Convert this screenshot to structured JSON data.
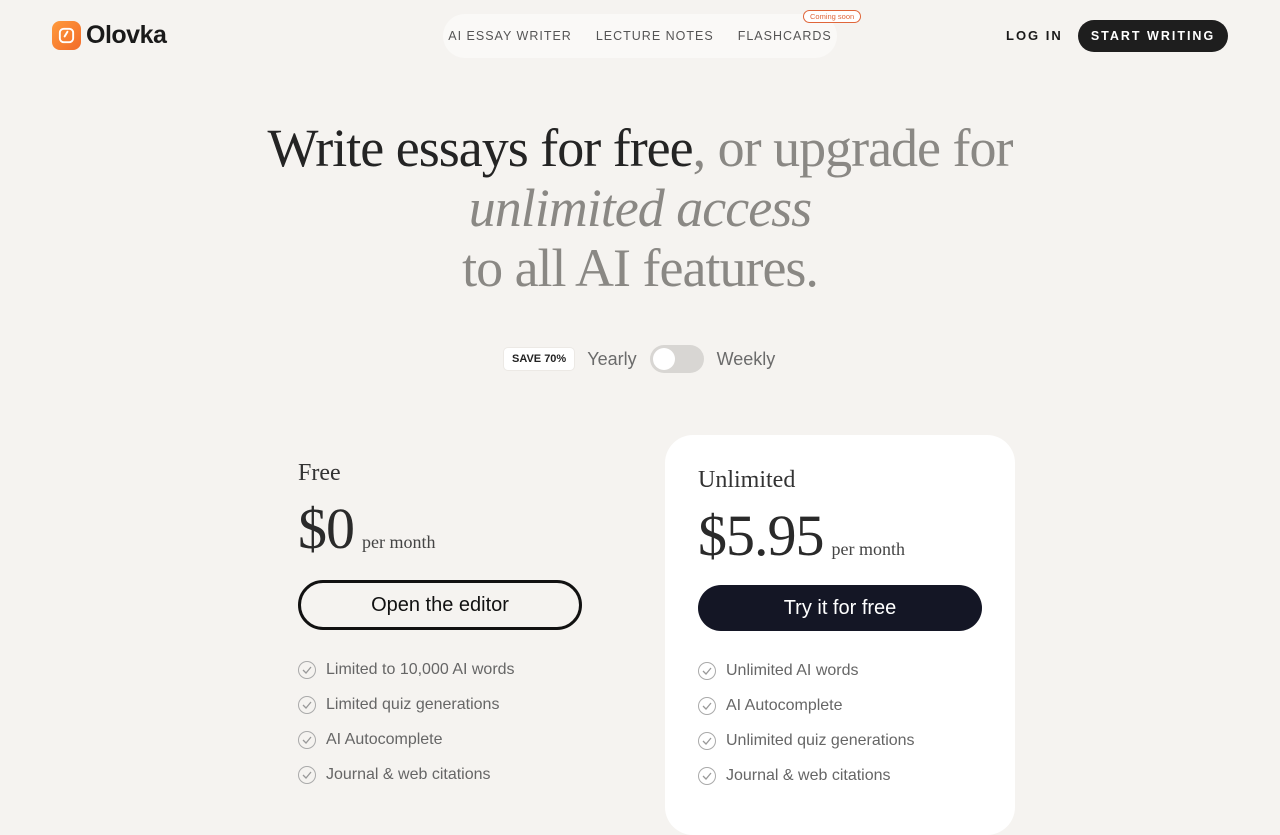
{
  "header": {
    "logo_text": "Olovka",
    "nav": [
      {
        "label": "AI ESSAY WRITER"
      },
      {
        "label": "LECTURE NOTES"
      },
      {
        "label": "FLASHCARDS"
      }
    ],
    "coming_soon": "Coming soon",
    "login": "LOG IN",
    "start_writing": "START WRITING"
  },
  "hero": {
    "part1": "Write essays for free",
    "part2": ", or upgrade for ",
    "part3": "unlimited access",
    "part4": "to all AI features."
  },
  "billing": {
    "save_badge": "SAVE 70%",
    "yearly": "Yearly",
    "weekly": "Weekly",
    "toggle_state": "yearly"
  },
  "plans": {
    "free": {
      "name": "Free",
      "price": "$0",
      "per": "per month",
      "button": "Open the editor",
      "features": [
        "Limited to 10,000 AI words",
        "Limited quiz generations",
        "AI Autocomplete",
        "Journal & web citations"
      ]
    },
    "unlimited": {
      "name": "Unlimited",
      "price": "$5.95",
      "per": "per month",
      "button": "Try it for free",
      "features": [
        "Unlimited AI words",
        "AI Autocomplete",
        "Unlimited quiz generations",
        "Journal & web citations"
      ]
    }
  },
  "colors": {
    "background": "#f5f3f0",
    "brand": "#f26b2a",
    "dark_button": "#141625"
  }
}
